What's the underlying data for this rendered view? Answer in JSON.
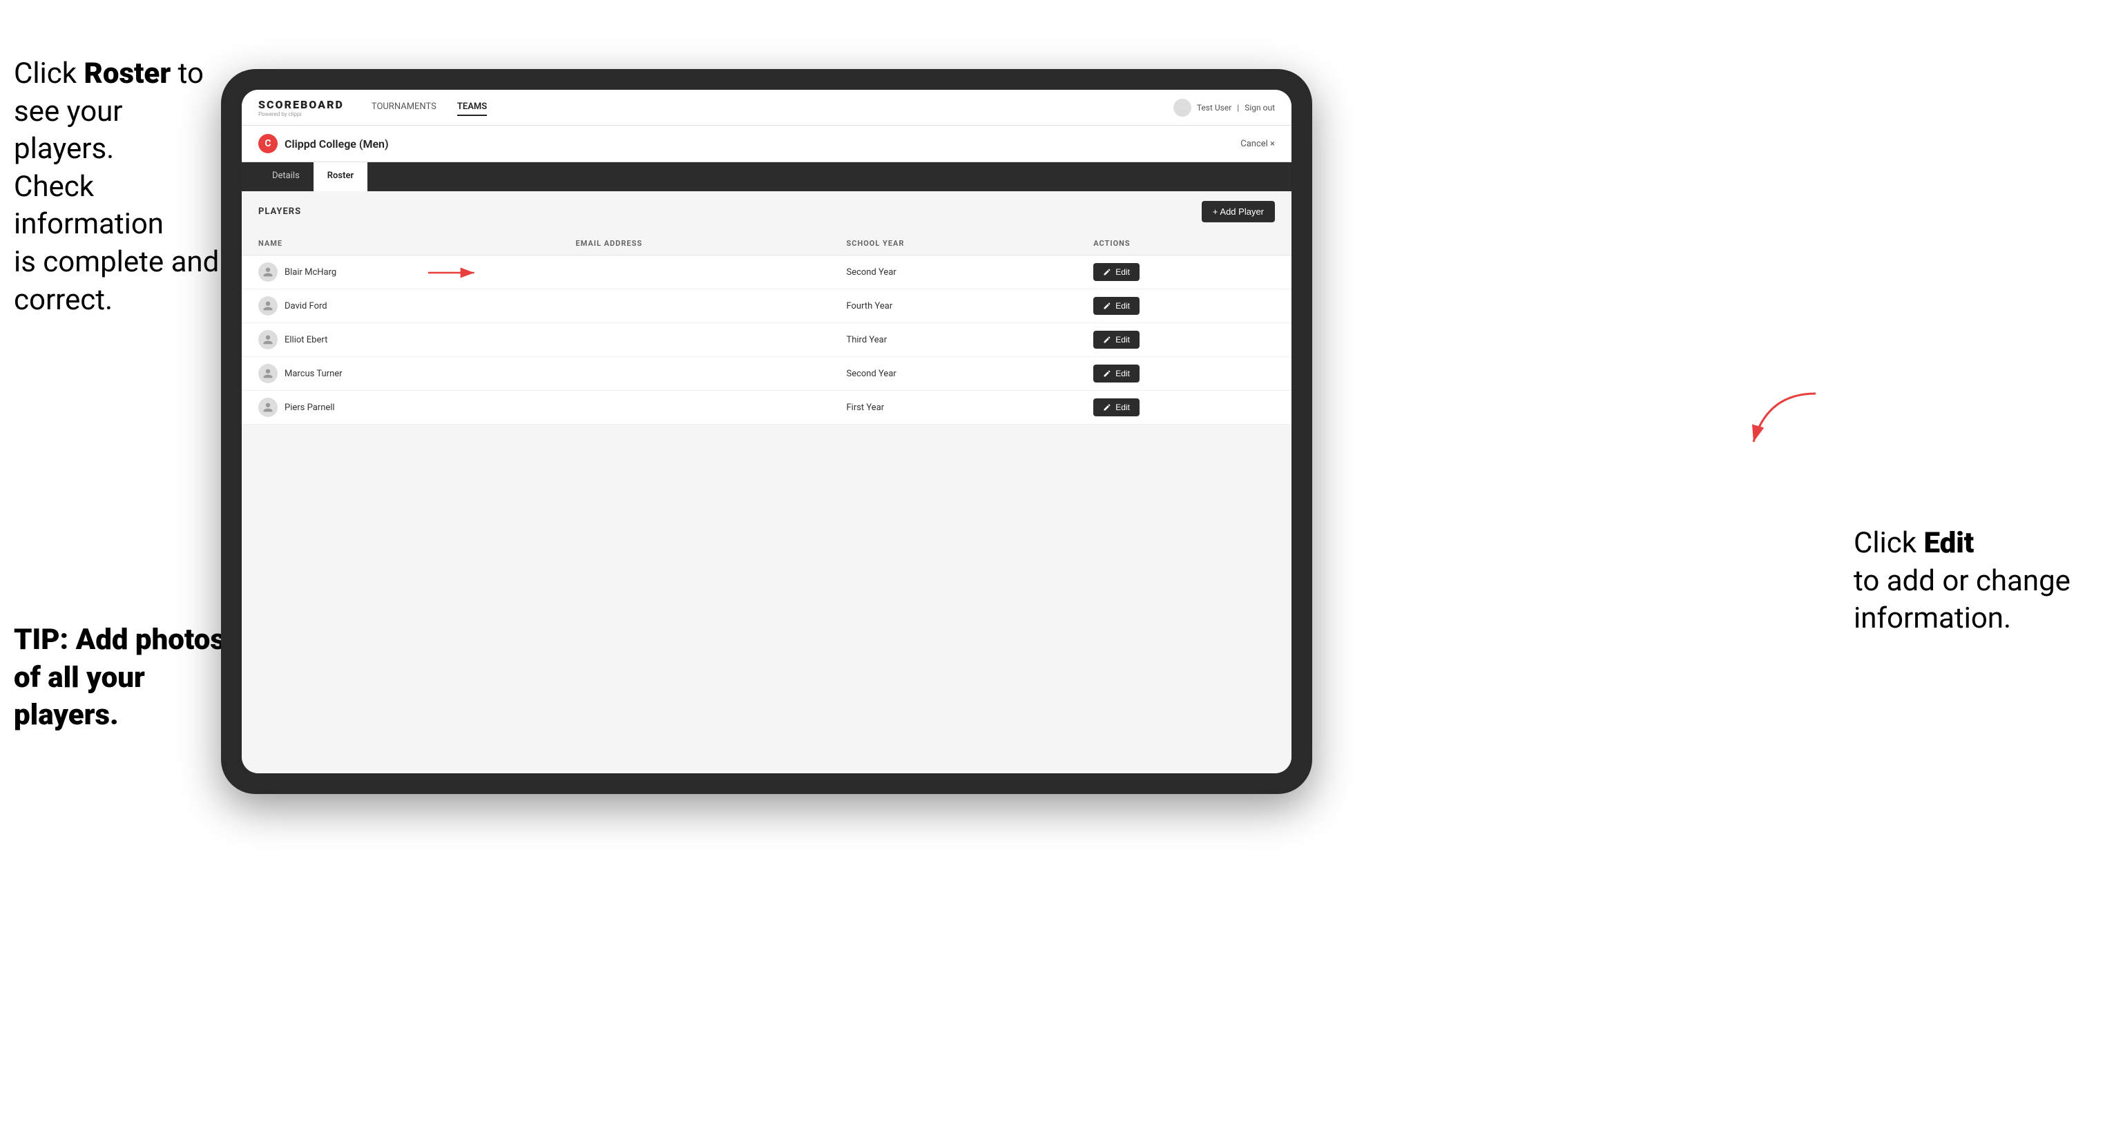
{
  "left_instructions": {
    "line1": "Click ",
    "bold1": "Roster",
    "line2": " to see your players. Check information is complete and correct."
  },
  "tip": {
    "text": "TIP: Add photos of all your players."
  },
  "right_instructions": {
    "line1": "Click ",
    "bold1": "Edit",
    "line2": " to add or change information."
  },
  "header": {
    "logo": "SCOREBOARD",
    "logo_sub": "Powered by clippi",
    "nav": [
      {
        "label": "TOURNAMENTS",
        "active": false
      },
      {
        "label": "TEAMS",
        "active": true
      }
    ],
    "user": "Test User",
    "signout": "Sign out"
  },
  "team": {
    "icon": "C",
    "name": "Clippd College (Men)",
    "cancel": "Cancel ×"
  },
  "tabs": [
    {
      "label": "Details",
      "active": false
    },
    {
      "label": "Roster",
      "active": true
    }
  ],
  "players_section": {
    "title": "PLAYERS",
    "add_button": "+ Add Player"
  },
  "table": {
    "columns": [
      "NAME",
      "EMAIL ADDRESS",
      "SCHOOL YEAR",
      "ACTIONS"
    ],
    "rows": [
      {
        "name": "Blair McHarg",
        "email": "",
        "school_year": "Second Year"
      },
      {
        "name": "David Ford",
        "email": "",
        "school_year": "Fourth Year"
      },
      {
        "name": "Elliot Ebert",
        "email": "",
        "school_year": "Third Year"
      },
      {
        "name": "Marcus Turner",
        "email": "",
        "school_year": "Second Year"
      },
      {
        "name": "Piers Parnell",
        "email": "",
        "school_year": "First Year"
      }
    ],
    "edit_label": "Edit"
  }
}
